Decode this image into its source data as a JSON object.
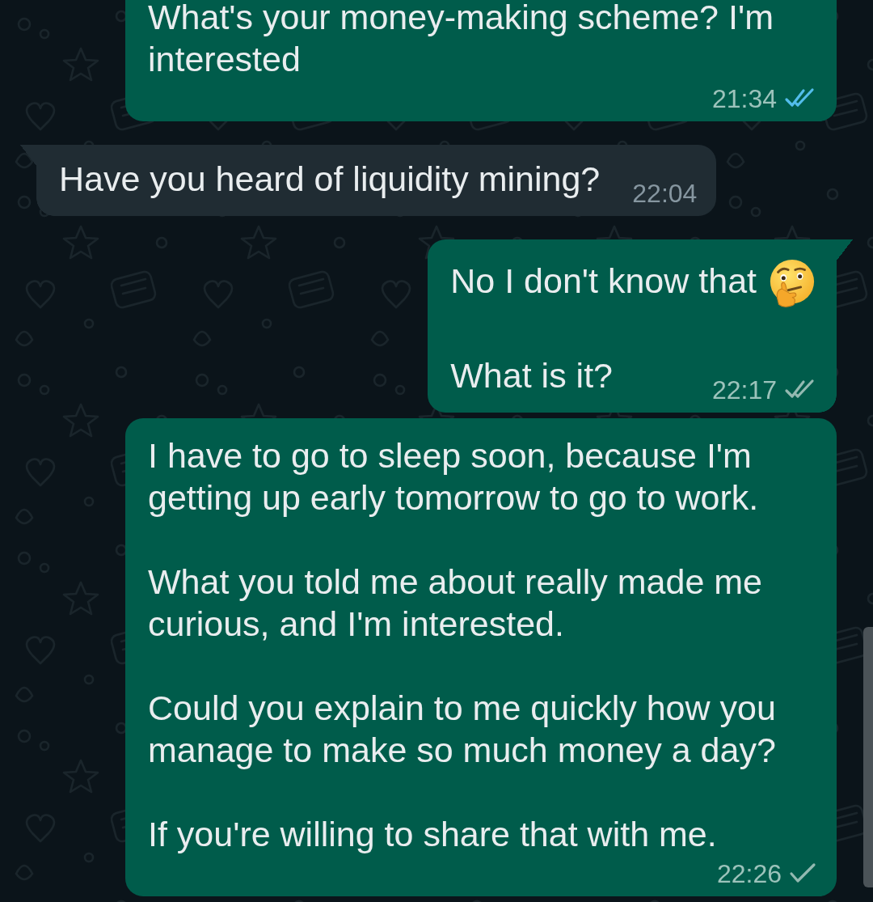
{
  "messages": [
    {
      "kind": "outgoing",
      "tail": false,
      "paragraphs": [
        {
          "kind": "plain",
          "text": "What's your money-making scheme? I'm interested"
        }
      ],
      "time": "21:34",
      "delivered": true,
      "read": true
    },
    {
      "kind": "incoming",
      "tail": true,
      "paragraphs": [
        {
          "kind": "plain",
          "text": "Have you heard of liquidity mining?"
        }
      ],
      "time": "22:04"
    },
    {
      "kind": "outgoing",
      "tail": true,
      "paragraphs": [
        {
          "kind": "emoji",
          "text": "No I don't know that"
        },
        {
          "kind": "plain",
          "text": "What is it?"
        }
      ],
      "time": "22:17",
      "delivered": true,
      "read": false
    },
    {
      "kind": "outgoing",
      "tail": false,
      "paragraphs": [
        {
          "kind": "plain",
          "text": "I have to go to sleep soon, because I'm getting up early tomorrow to go to work."
        },
        {
          "kind": "plain",
          "text": "What you told me about really made me curious, and I'm interested."
        },
        {
          "kind": "plain",
          "text": "Could you explain to me quickly how you manage to make so much money a day?"
        },
        {
          "kind": "plain",
          "text": "If you're willing to share that with me."
        }
      ],
      "time": "22:26",
      "delivered": false,
      "read": false
    }
  ]
}
